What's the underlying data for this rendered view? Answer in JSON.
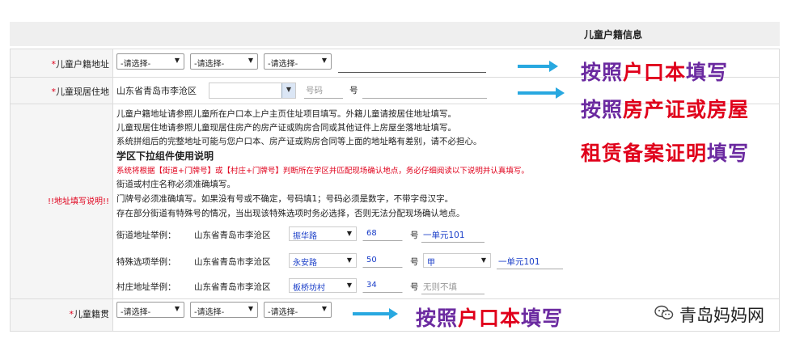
{
  "header": {
    "title": "儿童户籍信息"
  },
  "rows": {
    "huji": {
      "required_mark": "*",
      "label": "儿童户籍地址"
    },
    "xianzhu": {
      "required_mark": "*",
      "label": "儿童现居住地",
      "prefix": "山东省青岛市李沧区",
      "hao_placeholder": "号码",
      "hao_suffix": "号"
    },
    "shuoming": {
      "label": "!!地址填写说明!!"
    },
    "jiguan": {
      "required_mark": "*",
      "label": "儿童籍贯"
    }
  },
  "select_placeholder": "-请选择-",
  "instructions": {
    "line1": "儿童户籍地址请参照儿童所在户口本上户主页住址项目填写。外籍儿童请按居住地址填写。",
    "line2": "儿童现居住地请参照儿童现居住房产的房产证或购房合同或其他证件上房屋坐落地址填写。",
    "line3": "系统拼组后的完整地址可能与您户口本、房产证或购房合同等上面的地址略有差别，请不必担心。",
    "heading": "学区下拉组件使用说明",
    "red": "系统将根据【街道+门牌号】或【村庄+门牌号】判断所在学区并匹配现场确认地点，务必仔细阅读以下说明并认真填写。",
    "line4": "街道或村庄名称必须准确填写。",
    "line5": "门牌号必须准确填写。如果没有号或不确定，号码填1；号码必须是数字，不带字母汉字。",
    "line6": "存在部分街道有特殊号的情况，当出现该特殊选项时务必选择，否则无法分配现场确认地点。"
  },
  "examples": [
    {
      "label": "街道地址举例：",
      "district": "山东省青岛市李沧区",
      "street": "振华路",
      "number": "68",
      "hao": "号",
      "extra": "一单元101"
    },
    {
      "label": "特殊选项举例：",
      "district": "山东省青岛市李沧区",
      "street": "永安路",
      "number": "50",
      "hao": "号",
      "special": "甲",
      "extra": "一单元101"
    },
    {
      "label": "村庄地址举例：",
      "district": "山东省青岛市李沧区",
      "street": "板桥坊村",
      "number": "34",
      "hao": "号",
      "extra": "无则不填"
    }
  ],
  "annotations": {
    "a1": {
      "purple1": "按照",
      "red": "户口本",
      "purple2": "填写"
    },
    "a2": {
      "purple1": "按照",
      "red": "房产证或房屋"
    },
    "a3": {
      "red": "租赁备案证明",
      "purple2": "填写"
    },
    "a4": {
      "purple1": "按照",
      "red": "户口本",
      "purple2": "填写"
    }
  },
  "watermark": {
    "text": "青岛妈妈网",
    "icon": "wechat-icon"
  },
  "colors": {
    "arrow": "#28a8e0",
    "annotation_purple": "#6b2aa0",
    "annotation_red": "#e0001b",
    "link_blue": "#1a3ec8"
  }
}
